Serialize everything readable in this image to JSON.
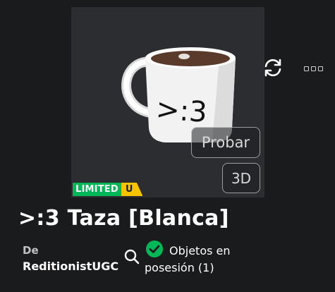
{
  "item": {
    "name": ">:3 Taza [Blanca]",
    "mug_text": ">:3",
    "try_on_label": "Probar",
    "view_3d_label": "3D",
    "limited_label": "LIMITED",
    "limited_u_label": "U"
  },
  "creator": {
    "by_label": "De",
    "name": "ReditionistUGC"
  },
  "ownership": {
    "line1": "Objetos en",
    "line2": "posesión (1)"
  },
  "icons": {
    "refresh": "refresh-icon",
    "more": "more-options-icon",
    "search": "search-icon",
    "owned": "check-circle-icon"
  },
  "colors": {
    "background": "#1a1b1d",
    "thumbnail_bg": "#2c2d30",
    "limited_green": "#02b757",
    "limited_yellow": "#f7c400",
    "check_green": "#02b757"
  }
}
